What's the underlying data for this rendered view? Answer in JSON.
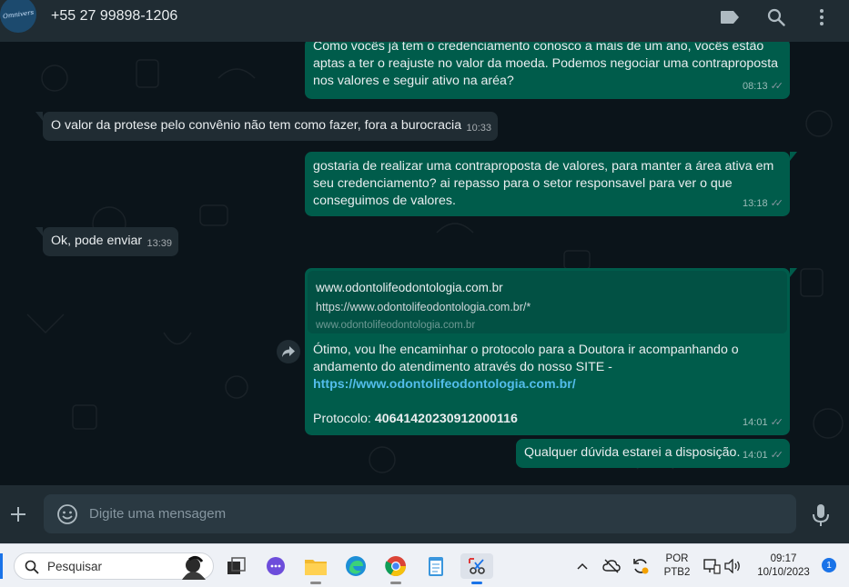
{
  "header": {
    "avatar_text": "Omnivers",
    "contact": "+55 27 99898-1206",
    "icons": [
      "label-icon",
      "search-icon",
      "menu-icon"
    ]
  },
  "messages": [
    {
      "dir": "out",
      "text": "Como vocês já tem o credenciamento conosco a mais de um ano, vocês estão\naptas a ter o reajuste no valor da moeda. Podemos negociar uma contraproposta\nnos valores e seguir ativo na aréa?",
      "time": "08:13"
    },
    {
      "dir": "in",
      "text": "O valor da protese pelo convênio não tem como fazer, fora a burocracia",
      "time": "10:33"
    },
    {
      "dir": "out",
      "text": "gostaria de realizar uma contraproposta de valores, para manter a área ativa em\nseu credenciamento? ai repasso para o setor responsavel para ver o que\nconseguimos de valores.",
      "time": "13:18"
    },
    {
      "dir": "in",
      "text": "Ok, pode enviar",
      "time": "13:39"
    },
    {
      "dir": "out",
      "preview": {
        "title": "www.odontolifeodontologia.com.br",
        "description": "https://www.odontolifeodontologia.com.br/*",
        "domain": "www.odontolifeodontologia.com.br"
      },
      "text": "Ótimo, vou lhe encaminhar o protocolo para a Doutora ir acompanhando o\nandamento do atendimento através do nosso SITE -",
      "link": "https://www.odontolifeodontologia.com.br/",
      "protocol_label": "Protocolo:",
      "protocol_value": "40641420230912000116",
      "time": "14:01"
    },
    {
      "dir": "out",
      "text": "Qualquer dúvida estarei a disposição.",
      "time": "14:01"
    }
  ],
  "composer": {
    "placeholder": "Digite uma mensagem",
    "value": ""
  },
  "taskbar": {
    "search_label": "Pesquisar",
    "apps": [
      "task-view-icon",
      "chat-icon",
      "file-explorer-icon",
      "edge-icon",
      "chrome-icon",
      "notepad-icon",
      "snipping-tool-icon"
    ],
    "lang_1": "POR",
    "lang_2": "PTB2",
    "time": "09:17",
    "date": "10/10/2023",
    "notifications": "1"
  },
  "colors": {
    "outgoing": "#005c4b",
    "incoming": "#202c33",
    "background": "#0b141a",
    "link": "#53bdeb"
  }
}
